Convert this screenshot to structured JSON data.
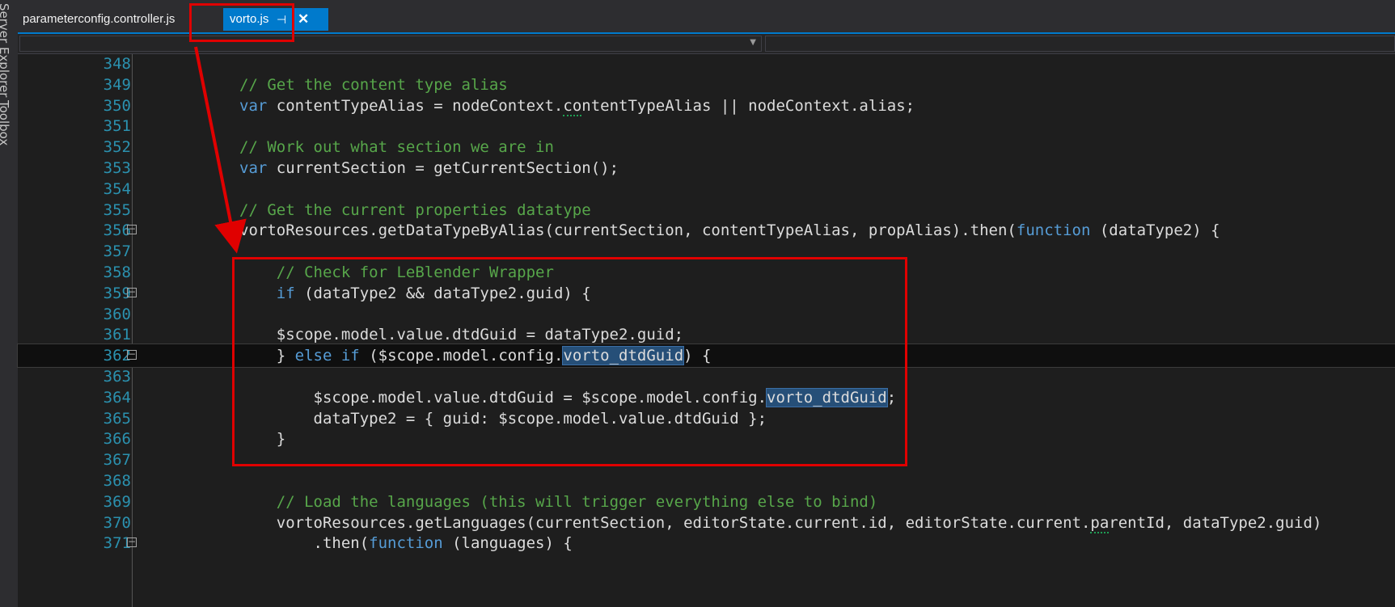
{
  "side_panel": {
    "items": [
      {
        "label": "Server Explorer",
        "icon": "server-explorer-icon"
      },
      {
        "label": "Toolbox",
        "icon": "toolbox-icon"
      }
    ]
  },
  "tabs": [
    {
      "label": "parameterconfig.controller.js",
      "active": false
    },
    {
      "label": "vorto.js",
      "active": true,
      "pin_icon": "pin-icon",
      "close_icon": "close-icon"
    }
  ],
  "editor": {
    "lines": [
      {
        "number": "348",
        "tokens": [
          {
            "t": "",
            "c": "plain"
          }
        ]
      },
      {
        "number": "349",
        "tokens": [
          {
            "t": "// Get the content type alias",
            "c": "cm"
          }
        ]
      },
      {
        "number": "350",
        "tokens": [
          {
            "t": "var",
            "c": "kw"
          },
          {
            "t": " contentTypeAlias = nodeContext.",
            "c": "plain"
          },
          {
            "t": "co",
            "c": "squig"
          },
          {
            "t": "ntentTypeAlias || nodeContext.alias;",
            "c": "plain"
          }
        ]
      },
      {
        "number": "351",
        "tokens": [
          {
            "t": "",
            "c": "plain"
          }
        ]
      },
      {
        "number": "352",
        "tokens": [
          {
            "t": "// Work out what section we are in",
            "c": "cm"
          }
        ]
      },
      {
        "number": "353",
        "tokens": [
          {
            "t": "var",
            "c": "kw"
          },
          {
            "t": " currentSection = getCurrentSection();",
            "c": "plain"
          }
        ]
      },
      {
        "number": "354",
        "tokens": [
          {
            "t": "",
            "c": "plain"
          }
        ]
      },
      {
        "number": "355",
        "tokens": [
          {
            "t": "// Get the current properties datatype",
            "c": "cm"
          }
        ]
      },
      {
        "number": "356",
        "fold": true,
        "tokens": [
          {
            "t": "vortoResources.getDataTypeByAlias(currentSection, contentTypeAlias, propAlias).then(",
            "c": "plain"
          },
          {
            "t": "function",
            "c": "kw"
          },
          {
            "t": " (dataType2) {",
            "c": "plain"
          }
        ]
      },
      {
        "number": "357",
        "tokens": [
          {
            "t": "",
            "c": "plain"
          }
        ]
      },
      {
        "number": "358",
        "tokens": [
          {
            "t": "    ",
            "c": "plain"
          },
          {
            "t": "// Check for LeBlender Wrapper",
            "c": "cm"
          }
        ]
      },
      {
        "number": "359",
        "fold": true,
        "tokens": [
          {
            "t": "    ",
            "c": "plain"
          },
          {
            "t": "if",
            "c": "kw"
          },
          {
            "t": " (dataType2 && dataType2.guid) {",
            "c": "plain"
          }
        ]
      },
      {
        "number": "360",
        "tokens": [
          {
            "t": "",
            "c": "plain"
          }
        ]
      },
      {
        "number": "361",
        "tokens": [
          {
            "t": "    $scope.model.value.dtdGuid = dataType2.guid;",
            "c": "plain"
          }
        ]
      },
      {
        "number": "362",
        "fold": true,
        "current": true,
        "tokens": [
          {
            "t": "    } ",
            "c": "plain"
          },
          {
            "t": "else",
            "c": "kw"
          },
          {
            "t": " ",
            "c": "plain"
          },
          {
            "t": "if",
            "c": "kw"
          },
          {
            "t": " ($scope.model.config.",
            "c": "plain"
          },
          {
            "t": "vorto_dtdGuid",
            "c": "sel"
          },
          {
            "t": ") {",
            "c": "plain"
          }
        ]
      },
      {
        "number": "363",
        "tokens": [
          {
            "t": "",
            "c": "plain"
          }
        ]
      },
      {
        "number": "364",
        "tokens": [
          {
            "t": "        $scope.model.value.dtdGuid = $scope.model.config.",
            "c": "plain"
          },
          {
            "t": "vorto_dtdGuid",
            "c": "sel"
          },
          {
            "t": ";",
            "c": "plain"
          }
        ]
      },
      {
        "number": "365",
        "tokens": [
          {
            "t": "        dataType2 = { guid: $scope.model.value.dtdGuid };",
            "c": "plain"
          }
        ]
      },
      {
        "number": "366",
        "tokens": [
          {
            "t": "    }",
            "c": "plain"
          }
        ]
      },
      {
        "number": "367",
        "tokens": [
          {
            "t": "",
            "c": "plain"
          }
        ]
      },
      {
        "number": "368",
        "tokens": [
          {
            "t": "",
            "c": "plain"
          }
        ]
      },
      {
        "number": "369",
        "tokens": [
          {
            "t": "    ",
            "c": "plain"
          },
          {
            "t": "// Load the languages (this will trigger everything else to bind)",
            "c": "cm"
          }
        ]
      },
      {
        "number": "370",
        "tokens": [
          {
            "t": "    vortoResources.getLanguages(currentSection, editorState.current.id, editorState.current.",
            "c": "plain"
          },
          {
            "t": "pa",
            "c": "squig"
          },
          {
            "t": "rentId, dataType2.guid)",
            "c": "plain"
          }
        ]
      },
      {
        "number": "371",
        "fold": true,
        "tokens": [
          {
            "t": "        .then(",
            "c": "plain"
          },
          {
            "t": "function",
            "c": "kw"
          },
          {
            "t": " (languages) {",
            "c": "plain"
          }
        ]
      }
    ]
  },
  "colors": {
    "accent": "#007acc",
    "comment": "#57a64a",
    "keyword": "#569cd6",
    "line_number": "#2b91af",
    "annotation": "#e00000"
  }
}
